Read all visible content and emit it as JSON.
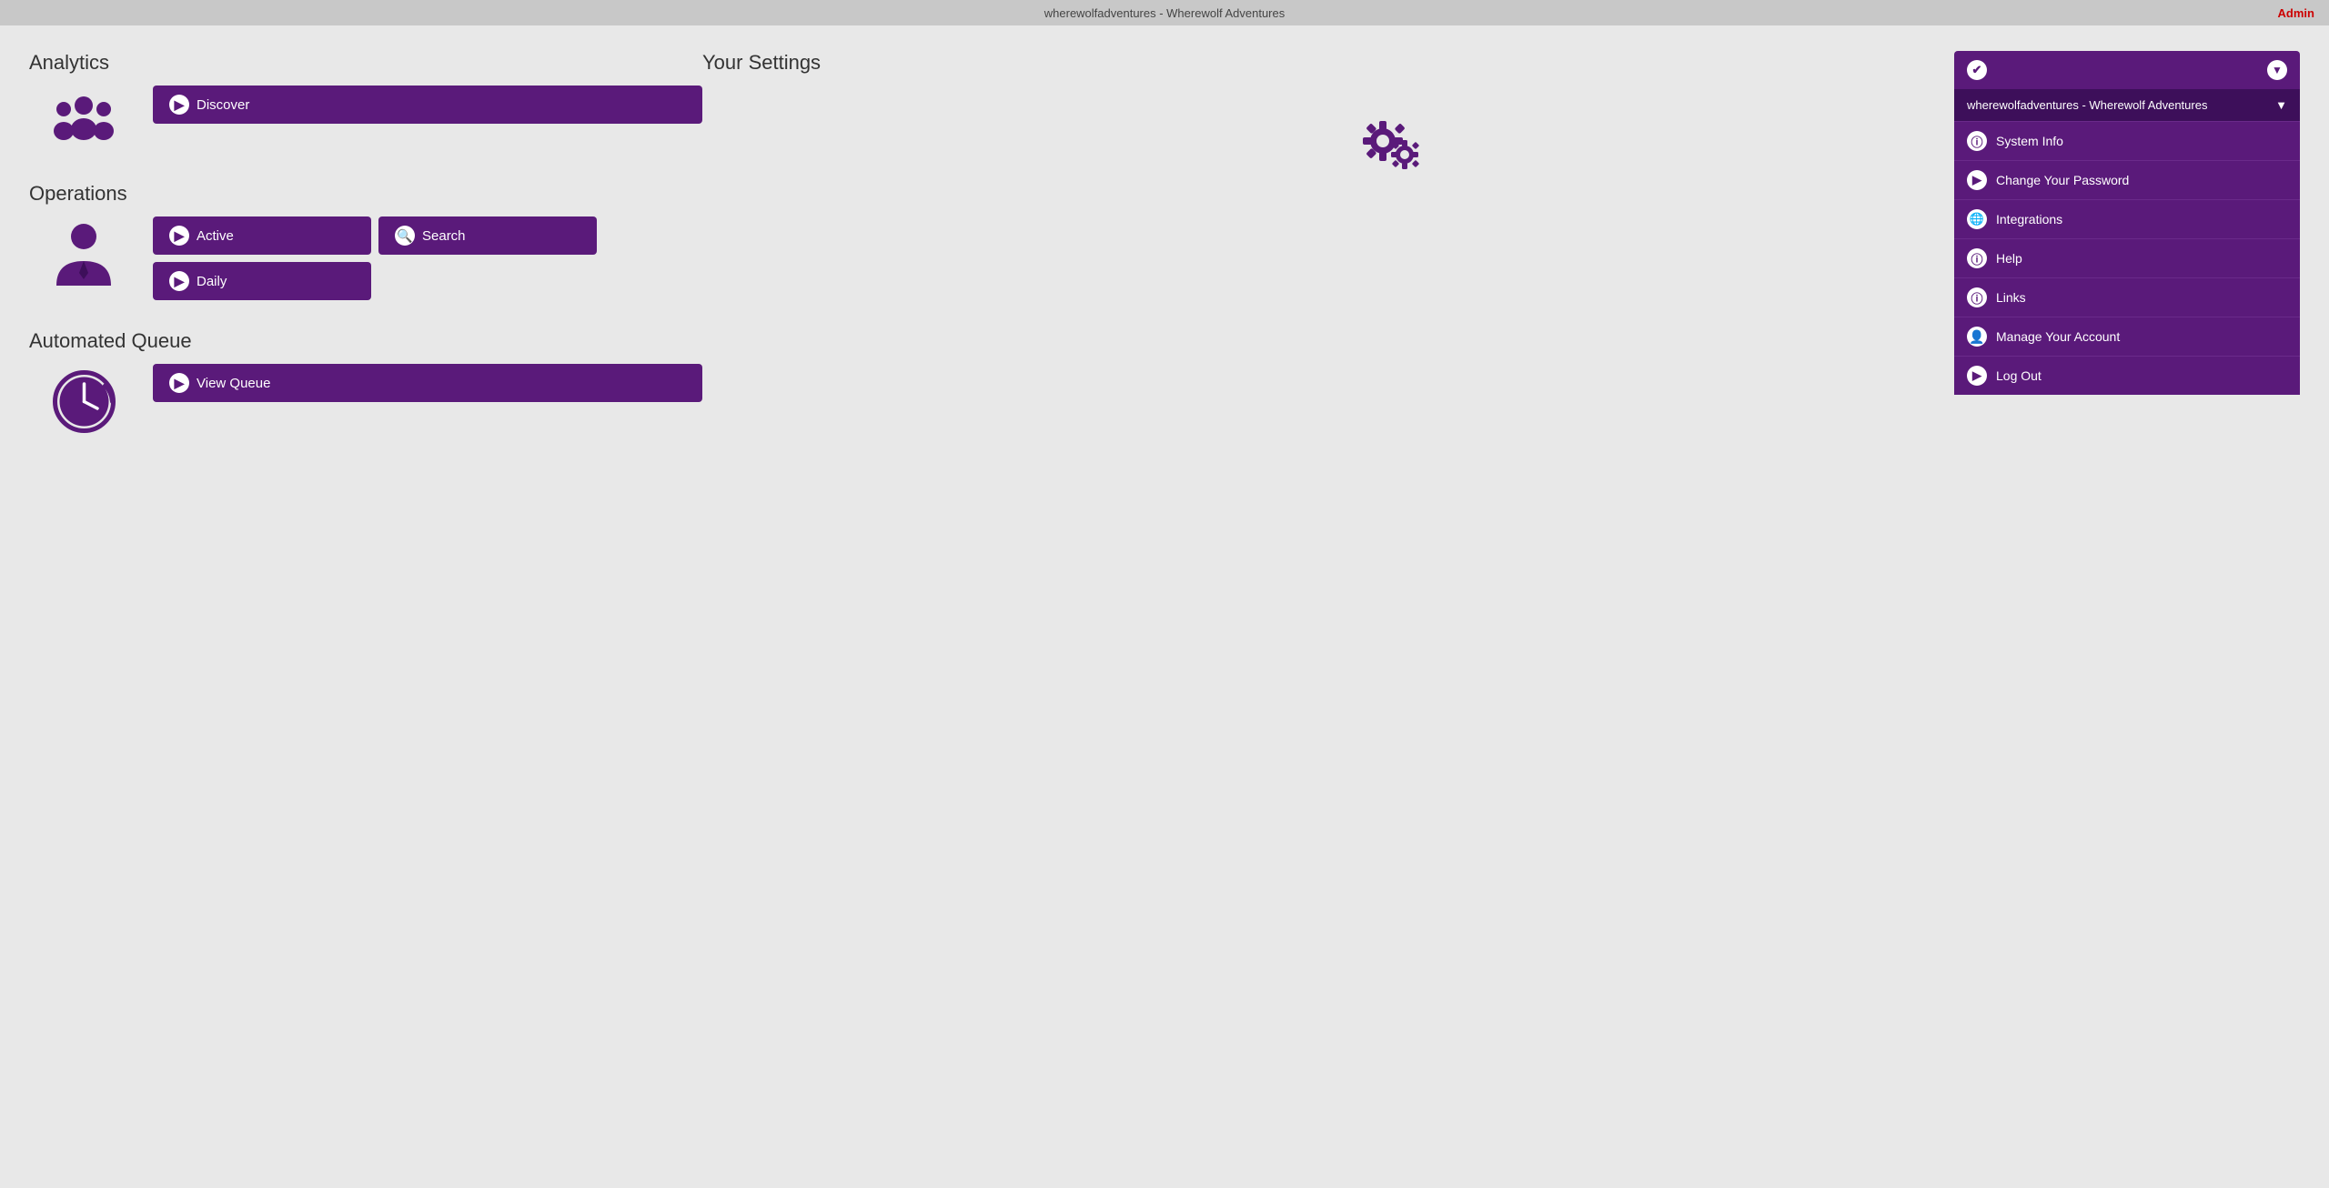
{
  "topbar": {
    "title": "wherewolfadventures - Wherewolf Adventures",
    "admin_label": "Admin"
  },
  "analytics": {
    "section_title": "Analytics",
    "buttons": [
      {
        "label": "Discover",
        "icon": "play-circle"
      }
    ]
  },
  "operations": {
    "section_title": "Operations",
    "buttons_row1": [
      {
        "label": "Active",
        "icon": "play-circle"
      },
      {
        "label": "Search",
        "icon": "search-circle"
      }
    ],
    "buttons_row2": [
      {
        "label": "Daily",
        "icon": "play-circle"
      }
    ]
  },
  "automated_queue": {
    "section_title": "Automated Queue",
    "buttons": [
      {
        "label": "View Queue",
        "icon": "play-circle"
      }
    ]
  },
  "your_settings": {
    "section_title": "Your Settings",
    "dropdown": {
      "check_icon": "✔",
      "select_value": "wherewolfadventures - Wherewolf Adventures",
      "arrow": "▼"
    },
    "menu_items": [
      {
        "label": "System Info",
        "icon": "info"
      },
      {
        "label": "Change Your Password",
        "icon": "arrow-right"
      },
      {
        "label": "Integrations",
        "icon": "globe"
      },
      {
        "label": "Help",
        "icon": "info"
      },
      {
        "label": "Links",
        "icon": "info"
      },
      {
        "label": "Manage Your Account",
        "icon": "person-circle"
      },
      {
        "label": "Log Out",
        "icon": "arrow-right"
      }
    ]
  }
}
